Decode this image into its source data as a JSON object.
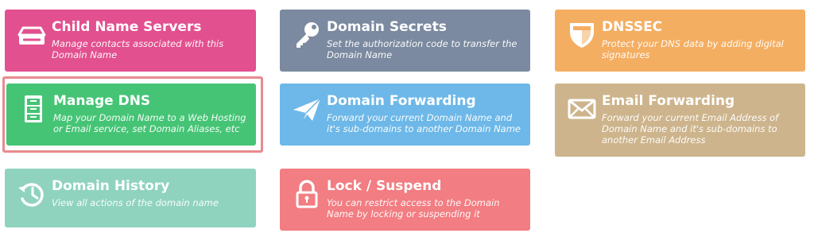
{
  "cards": [
    {
      "title": "Child Name Servers",
      "desc": "Manage contacts associated with this Domain Name",
      "color": "#e2508f",
      "icon": "drive-tray-icon"
    },
    {
      "title": "Domain Secrets",
      "desc": "Set the authorization code to transfer the Domain Name",
      "color": "#7b8aa0",
      "icon": "key-icon"
    },
    {
      "title": "DNSSEC",
      "desc": "Protect your DNS data by adding digital signatures",
      "color": "#f4ae62",
      "icon": "shield-icon"
    },
    {
      "title": "Manage DNS",
      "desc": "Map your Domain Name to a Web Hosting or Email service, set Domain Aliases, etc",
      "color": "#45c475",
      "icon": "filing-cabinet-icon",
      "selected": true
    },
    {
      "title": "Domain Forwarding",
      "desc": "Forward your current Domain Name and it's sub-domains to another Domain Name",
      "color": "#6db8e8",
      "icon": "paper-plane-icon"
    },
    {
      "title": "Email Forwarding",
      "desc": "Forward your current Email Address of Domain Name and it's sub-domains to another Email Address",
      "color": "#cdb48c",
      "icon": "envelope-icon"
    },
    {
      "title": "Domain History",
      "desc": "View all actions of the domain name",
      "color": "#8fd3bf",
      "icon": "history-clock-icon"
    },
    {
      "title": "Lock / Suspend",
      "desc": "You can restrict access to the Domain Name by locking or suspending it",
      "color": "#f27d82",
      "icon": "padlock-icon"
    }
  ],
  "selected_outline_color": "#e88a8e"
}
